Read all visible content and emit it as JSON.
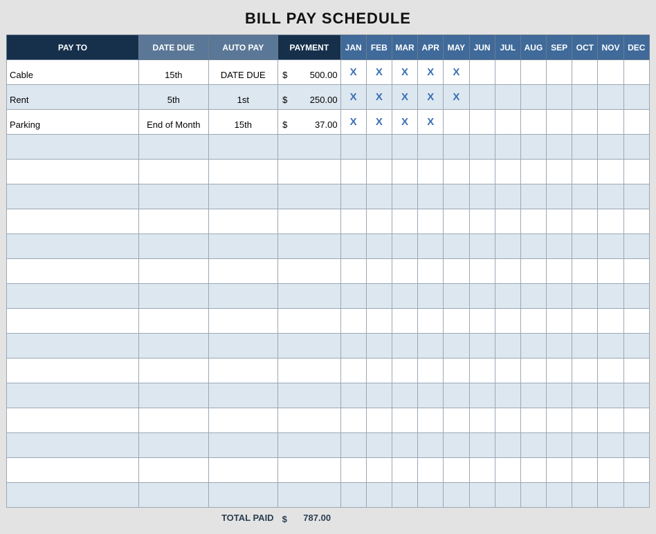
{
  "title": "BILL PAY SCHEDULE",
  "chart_data": {
    "type": "table",
    "columns": [
      "PAY TO",
      "DATE DUE",
      "AUTO PAY",
      "PAYMENT",
      "JAN",
      "FEB",
      "MAR",
      "APR",
      "MAY",
      "JUN",
      "JUL",
      "AUG",
      "SEP",
      "OCT",
      "NOV",
      "DEC"
    ],
    "rows": [
      {
        "pay_to": "Cable",
        "date_due": "15th",
        "auto_pay": "DATE DUE",
        "payment": "500.00",
        "months": [
          "X",
          "X",
          "X",
          "X",
          "X",
          "",
          "",
          "",
          "",
          "",
          "",
          ""
        ]
      },
      {
        "pay_to": "Rent",
        "date_due": "5th",
        "auto_pay": "1st",
        "payment": "250.00",
        "months": [
          "X",
          "X",
          "X",
          "X",
          "X",
          "",
          "",
          "",
          "",
          "",
          "",
          ""
        ]
      },
      {
        "pay_to": "Parking",
        "date_due": "End of Month",
        "auto_pay": "15th",
        "payment": "37.00",
        "months": [
          "X",
          "X",
          "X",
          "X",
          "",
          "",
          "",
          "",
          "",
          "",
          "",
          ""
        ]
      },
      {
        "pay_to": "",
        "date_due": "",
        "auto_pay": "",
        "payment": "",
        "months": [
          "",
          "",
          "",
          "",
          "",
          "",
          "",
          "",
          "",
          "",
          "",
          ""
        ]
      },
      {
        "pay_to": "",
        "date_due": "",
        "auto_pay": "",
        "payment": "",
        "months": [
          "",
          "",
          "",
          "",
          "",
          "",
          "",
          "",
          "",
          "",
          "",
          ""
        ]
      },
      {
        "pay_to": "",
        "date_due": "",
        "auto_pay": "",
        "payment": "",
        "months": [
          "",
          "",
          "",
          "",
          "",
          "",
          "",
          "",
          "",
          "",
          "",
          ""
        ]
      },
      {
        "pay_to": "",
        "date_due": "",
        "auto_pay": "",
        "payment": "",
        "months": [
          "",
          "",
          "",
          "",
          "",
          "",
          "",
          "",
          "",
          "",
          "",
          ""
        ]
      },
      {
        "pay_to": "",
        "date_due": "",
        "auto_pay": "",
        "payment": "",
        "months": [
          "",
          "",
          "",
          "",
          "",
          "",
          "",
          "",
          "",
          "",
          "",
          ""
        ]
      },
      {
        "pay_to": "",
        "date_due": "",
        "auto_pay": "",
        "payment": "",
        "months": [
          "",
          "",
          "",
          "",
          "",
          "",
          "",
          "",
          "",
          "",
          "",
          ""
        ]
      },
      {
        "pay_to": "",
        "date_due": "",
        "auto_pay": "",
        "payment": "",
        "months": [
          "",
          "",
          "",
          "",
          "",
          "",
          "",
          "",
          "",
          "",
          "",
          ""
        ]
      },
      {
        "pay_to": "",
        "date_due": "",
        "auto_pay": "",
        "payment": "",
        "months": [
          "",
          "",
          "",
          "",
          "",
          "",
          "",
          "",
          "",
          "",
          "",
          ""
        ]
      },
      {
        "pay_to": "",
        "date_due": "",
        "auto_pay": "",
        "payment": "",
        "months": [
          "",
          "",
          "",
          "",
          "",
          "",
          "",
          "",
          "",
          "",
          "",
          ""
        ]
      },
      {
        "pay_to": "",
        "date_due": "",
        "auto_pay": "",
        "payment": "",
        "months": [
          "",
          "",
          "",
          "",
          "",
          "",
          "",
          "",
          "",
          "",
          "",
          ""
        ]
      },
      {
        "pay_to": "",
        "date_due": "",
        "auto_pay": "",
        "payment": "",
        "months": [
          "",
          "",
          "",
          "",
          "",
          "",
          "",
          "",
          "",
          "",
          "",
          ""
        ]
      },
      {
        "pay_to": "",
        "date_due": "",
        "auto_pay": "",
        "payment": "",
        "months": [
          "",
          "",
          "",
          "",
          "",
          "",
          "",
          "",
          "",
          "",
          "",
          ""
        ]
      },
      {
        "pay_to": "",
        "date_due": "",
        "auto_pay": "",
        "payment": "",
        "months": [
          "",
          "",
          "",
          "",
          "",
          "",
          "",
          "",
          "",
          "",
          "",
          ""
        ]
      },
      {
        "pay_to": "",
        "date_due": "",
        "auto_pay": "",
        "payment": "",
        "months": [
          "",
          "",
          "",
          "",
          "",
          "",
          "",
          "",
          "",
          "",
          "",
          ""
        ]
      },
      {
        "pay_to": "",
        "date_due": "",
        "auto_pay": "",
        "payment": "",
        "months": [
          "",
          "",
          "",
          "",
          "",
          "",
          "",
          "",
          "",
          "",
          "",
          ""
        ]
      }
    ],
    "total_label": "TOTAL PAID",
    "total_currency": "$",
    "total_value": "787.00"
  },
  "currency": "$"
}
